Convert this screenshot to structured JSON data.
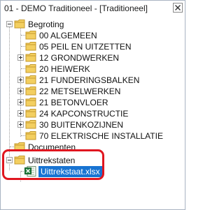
{
  "window": {
    "title": "01 - DEMO Traditioneel - [Traditioneel]"
  },
  "colors": {
    "selection": "#1874d2",
    "highlight": "#e0161f",
    "folder": "#f3cf60"
  },
  "icons": {
    "close": "close-icon",
    "folder": "folder-icon",
    "xlsx": "excel-file-icon"
  },
  "tree": {
    "root": {
      "label": "Begroting",
      "expanded": true
    },
    "begroting_items": [
      {
        "label": "00 ALGEMEEN",
        "has_children": false
      },
      {
        "label": "05 PEIL EN UITZETTEN",
        "has_children": false
      },
      {
        "label": "12 GRONDWERKEN",
        "has_children": true
      },
      {
        "label": "20 HEIWERK",
        "has_children": false
      },
      {
        "label": "21 FUNDERINGSBALKEN",
        "has_children": true
      },
      {
        "label": "22 METSELWERKEN",
        "has_children": true
      },
      {
        "label": "21 BETONVLOER",
        "has_children": true
      },
      {
        "label": "24 KAPCONSTRUCTIE",
        "has_children": true
      },
      {
        "label": "30 BUITENKOZIJNEN",
        "has_children": true
      },
      {
        "label": "70 ELEKTRISCHE INSTALLATIE",
        "has_children": false
      }
    ],
    "documenten": {
      "label": "Documenten"
    },
    "uittrekstaten": {
      "label": "Uittrekstaten",
      "expanded": true,
      "file": {
        "label": "Uittrekstaat.xlsx",
        "selected": true
      }
    }
  }
}
